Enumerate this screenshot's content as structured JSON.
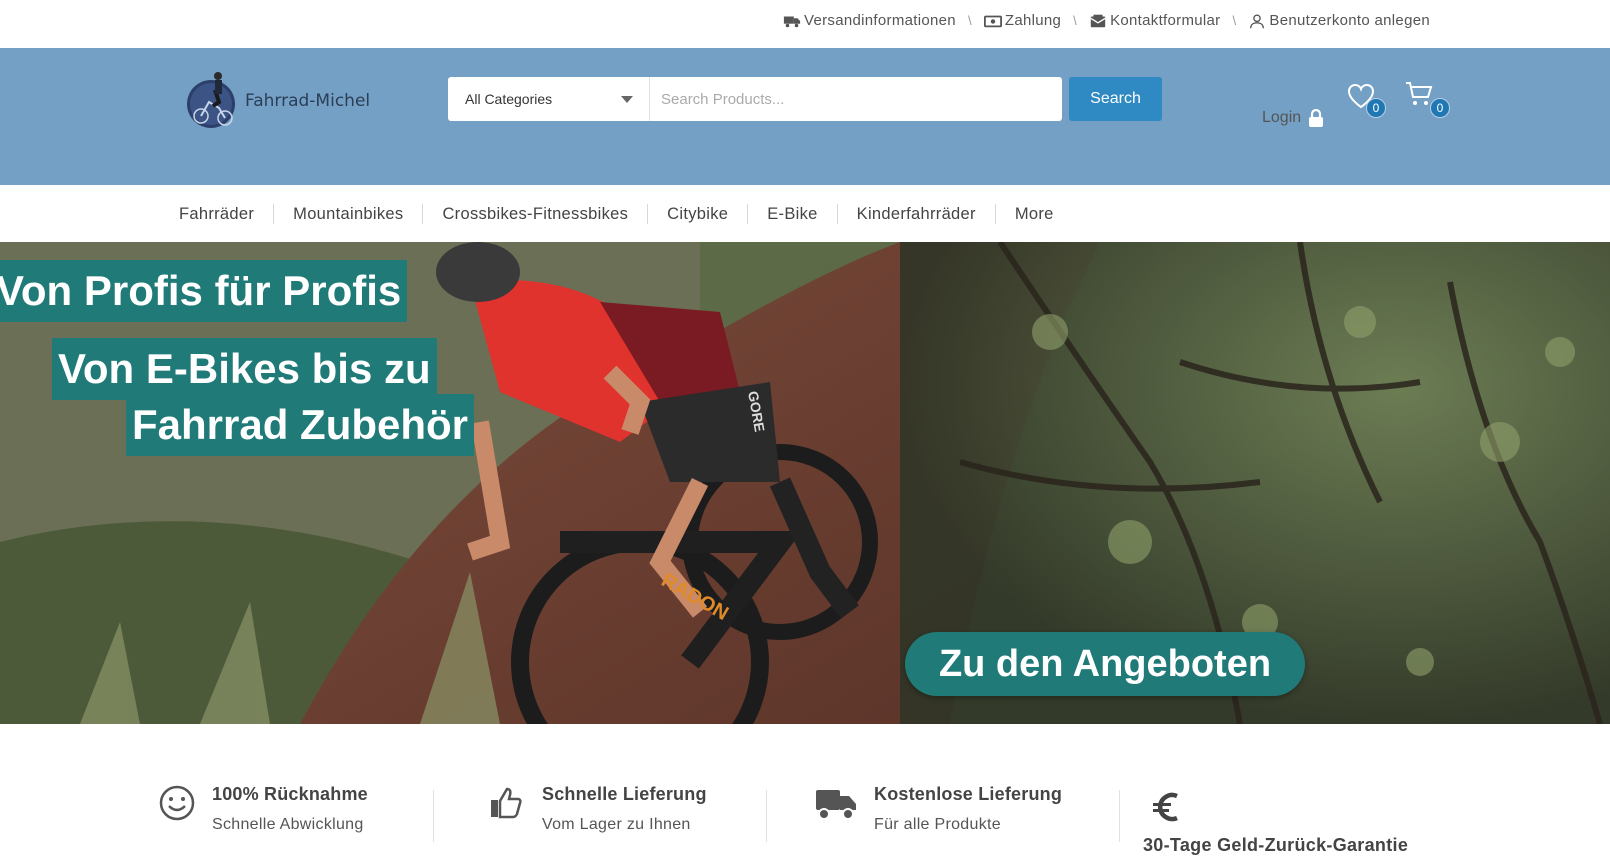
{
  "topbar": {
    "links": [
      {
        "label": "Versandinformationen",
        "icon": "truck-icon"
      },
      {
        "label": "Zahlung",
        "icon": "money-icon"
      },
      {
        "label": "Kontaktformular",
        "icon": "mail-icon"
      },
      {
        "label": "Benutzerkonto anlegen",
        "icon": "user-icon"
      }
    ],
    "separator": "\\"
  },
  "header": {
    "logo_text": "Fahrrad-Michel",
    "search": {
      "category": "All Categories",
      "placeholder": "Search Products...",
      "value": "",
      "button": "Search"
    },
    "login_label": "Login",
    "wishlist_count": "0",
    "cart_count": "0"
  },
  "nav": {
    "items": [
      "Fahrräder",
      "Mountainbikes",
      "Crossbikes-Fitnessbikes",
      "Citybike",
      "E-Bike",
      "Kinderfahrräder",
      "More"
    ]
  },
  "hero": {
    "line1": "Von Profis für Profis",
    "line2": "Von E-Bikes bis zu",
    "line3": "Fahrrad Zubehör",
    "cta": "Zu den Angeboten",
    "frame_text": "GORE",
    "bike_brand": "RADON"
  },
  "features": [
    {
      "title": "100% Rücknahme",
      "subtitle": "Schnelle Abwicklung",
      "icon": "smiley-icon"
    },
    {
      "title": "Schnelle Lieferung",
      "subtitle": "Vom Lager zu Ihnen",
      "icon": "thumbs-up-icon"
    },
    {
      "title": "Kostenlose Lieferung",
      "subtitle": "Für alle Produkte",
      "icon": "truck-icon"
    },
    {
      "title": "30-Tage Geld-Zurück-Garantie",
      "subtitle": "",
      "icon": "euro-icon"
    }
  ],
  "colors": {
    "header_bg": "#73a0c4",
    "accent_teal": "#1f7a78",
    "search_button": "#2f89c3",
    "badge": "#1f78b4"
  }
}
